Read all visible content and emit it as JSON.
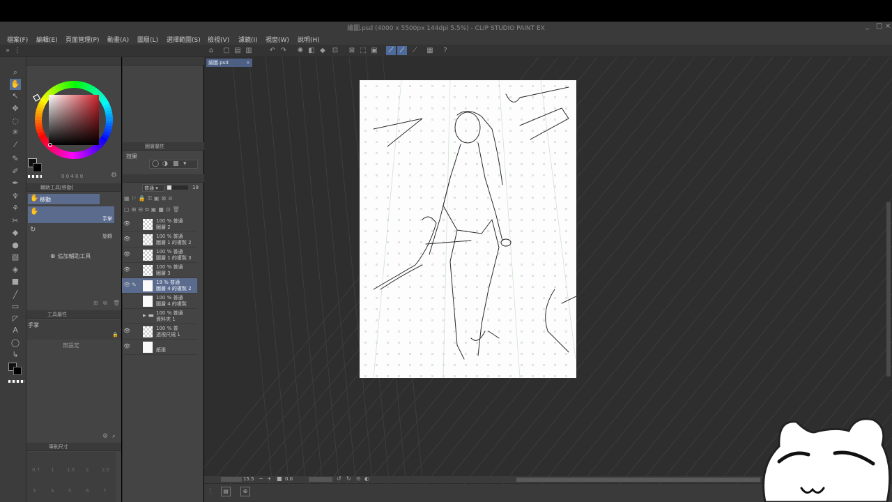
{
  "window": {
    "title": "繪圖.psd (4000 x 5500px 144dpi 5.5%) - CLIP STUDIO PAINT EX",
    "controls": [
      "_",
      "□",
      "×"
    ]
  },
  "menu": [
    "檔案(F)",
    "編輯(E)",
    "頁面管理(P)",
    "動畫(A)",
    "圖層(L)",
    "選擇範圍(S)",
    "檢視(V)",
    "濾鏡(I)",
    "視窗(W)",
    "說明(H)"
  ],
  "canvas": {
    "tab_label": "繪圖.psd",
    "tab_close": "×"
  },
  "color_panel": {
    "readout": "0 0 4 0 0"
  },
  "subtool_panel": {
    "title": "輔助工具[移動]",
    "items": [
      {
        "label": "移動",
        "selected": true
      },
      {
        "label": "手掌",
        "selected": false
      },
      {
        "label": "旋轉",
        "selected": false
      }
    ],
    "add_label": "追加輔助工具"
  },
  "tool_property": {
    "title": "工具屬性",
    "tool_name": "手掌",
    "no_setting": "無設定"
  },
  "brush_size": {
    "title": "筆刷尺寸",
    "values": [
      "0.7",
      "1",
      "1.5",
      "2",
      "2.5",
      "3",
      "4",
      "5",
      "6",
      "7"
    ]
  },
  "layer_property": {
    "title": "圖層屬性",
    "effect_label": "效果"
  },
  "layer_panel": {
    "blend_mode": "普通",
    "opacity": "19",
    "layers": [
      {
        "mode": "100 % 普通",
        "name": "圖層 2",
        "eye": true,
        "sel": false,
        "thumb": "check"
      },
      {
        "mode": "100 % 普通",
        "name": "圖層 1 的複製 2",
        "eye": true,
        "sel": false,
        "thumb": "check"
      },
      {
        "mode": "100 % 普通",
        "name": "圖層 1 的複製 3",
        "eye": true,
        "sel": false,
        "thumb": "check"
      },
      {
        "mode": "100 % 普通",
        "name": "圖層 3",
        "eye": true,
        "sel": false,
        "thumb": "check"
      },
      {
        "mode": "19 % 普通",
        "name": "圖層 4 的複製 2",
        "eye": true,
        "sel": true,
        "thumb": "plain"
      },
      {
        "mode": "100 % 普通",
        "name": "圖層 4 的複製",
        "eye": false,
        "sel": false,
        "thumb": "plain"
      },
      {
        "mode": "100 % 普通",
        "name": "資料夾 1",
        "eye": false,
        "sel": false,
        "thumb": "folder"
      },
      {
        "mode": "100 % 普",
        "name": "透視尺規 1",
        "eye": true,
        "sel": false,
        "thumb": "check"
      },
      {
        "mode": "",
        "name": "紙張",
        "eye": true,
        "sel": false,
        "thumb": "plain"
      }
    ]
  },
  "navigator": {
    "zoom": "15.5",
    "angle": "0.0"
  },
  "colors": {
    "accent": "#5b6b8d",
    "panel": "#444444",
    "canvas_bg": "#2e2e2e",
    "paper": "#fdfdfd"
  }
}
